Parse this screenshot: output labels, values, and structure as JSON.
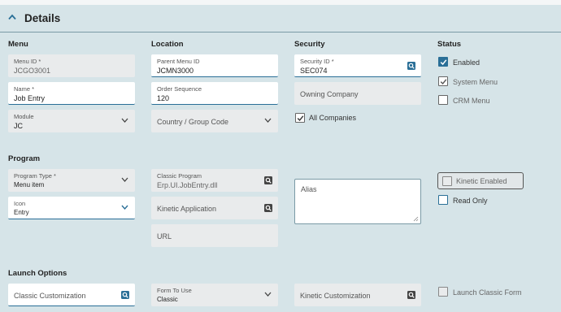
{
  "header": {
    "title": "Details"
  },
  "sections": {
    "menu": "Menu",
    "location": "Location",
    "security": "Security",
    "status": "Status",
    "program": "Program",
    "launch_options": "Launch Options"
  },
  "menu": {
    "menu_id": {
      "label": "Menu ID *",
      "value": "JCGO3001"
    },
    "name": {
      "label": "Name *",
      "value": "Job Entry"
    },
    "module": {
      "label": "Module",
      "value": "JC"
    }
  },
  "location": {
    "parent_menu_id": {
      "label": "Parent Menu ID",
      "value": "JCMN3000"
    },
    "order_sequence": {
      "label": "Order Sequence",
      "value": "120"
    },
    "country_group_code": {
      "placeholder": "Country / Group Code"
    }
  },
  "security": {
    "security_id": {
      "label": "Security ID *",
      "value": "SEC074"
    },
    "owning_company": {
      "placeholder": "Owning Company"
    },
    "all_companies": {
      "label": "All Companies",
      "checked": true
    }
  },
  "status": {
    "enabled": {
      "label": "Enabled",
      "checked": true
    },
    "system_menu": {
      "label": "System Menu",
      "checked": true
    },
    "crm_menu": {
      "label": "CRM Menu",
      "checked": false
    }
  },
  "program": {
    "program_type": {
      "label": "Program Type *",
      "value": "Menu item"
    },
    "icon": {
      "label": "Icon",
      "value": "Entry"
    },
    "classic_program": {
      "label": "Classic Program",
      "value": "Erp.UI.JobEntry.dll"
    },
    "kinetic_application": {
      "placeholder": "Kinetic Application"
    },
    "url": {
      "placeholder": "URL"
    },
    "alias": {
      "placeholder": "Alias"
    },
    "kinetic_enabled": {
      "label": "Kinetic Enabled",
      "checked": false
    },
    "read_only": {
      "label": "Read Only",
      "checked": false
    }
  },
  "launch": {
    "classic_customization": {
      "placeholder": "Classic Customization"
    },
    "form_to_use": {
      "label": "Form To Use",
      "value": "Classic"
    },
    "kinetic_customization": {
      "placeholder": "Kinetic Customization"
    },
    "launch_classic_form": {
      "label": "Launch Classic Form",
      "checked": false
    }
  },
  "colors": {
    "accent": "#2a6f97",
    "background": "#d6e4e8",
    "field": "#e9ebec"
  }
}
